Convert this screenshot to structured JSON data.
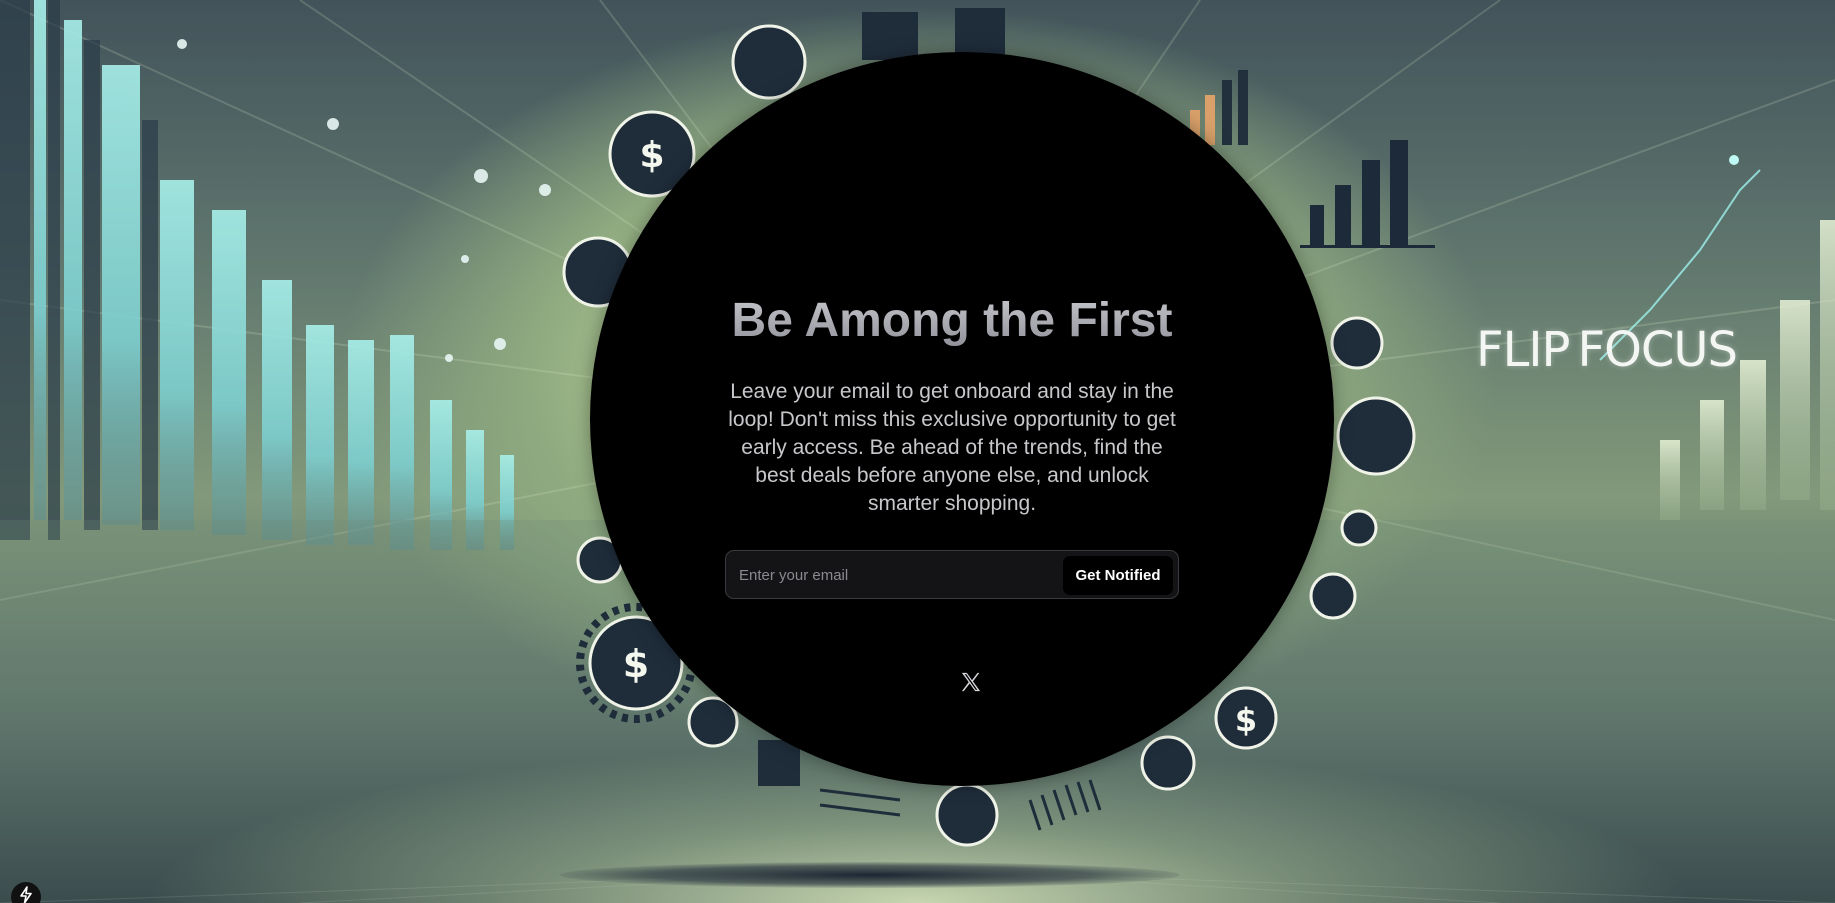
{
  "hero": {
    "title": "Be Among the First",
    "description": "Leave your email to get onboard and stay in the loop! Don't miss this exclusive opportunity to get early access. Be ahead of the trends, find the best deals before anyone else, and unlock smarter shopping."
  },
  "form": {
    "email_placeholder": "Enter your email",
    "email_value": "",
    "submit_label": "Get Notified"
  },
  "brand": {
    "logo_part1": "FLIP",
    "logo_part2": "FOCUS"
  },
  "social": {
    "icon": "x-logo-icon"
  },
  "badge": {
    "icon": "lightning-bolt-icon"
  },
  "colors": {
    "circle_bg": "#000000",
    "button_bg": "#000000",
    "button_text": "#ffffff",
    "title_gradient_top": "#c9c9cf",
    "title_gradient_bottom": "#8e8e97"
  }
}
